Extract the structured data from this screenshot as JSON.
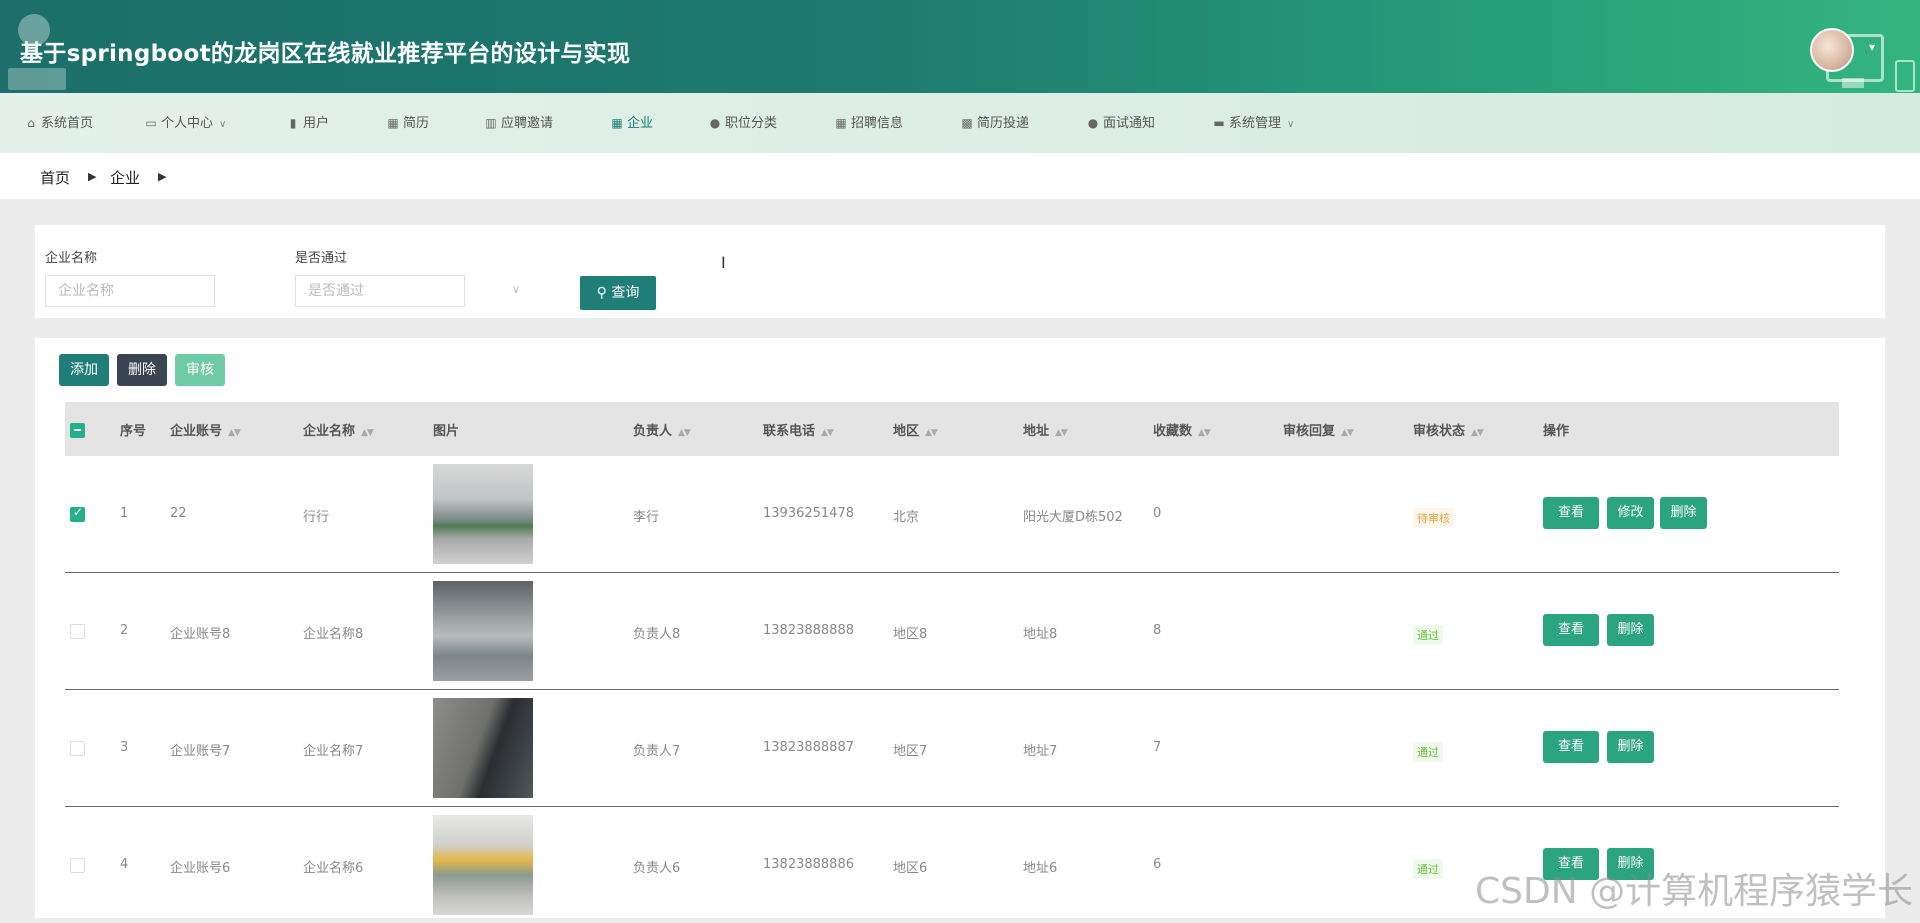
{
  "header": {
    "title": "基于springboot的龙岗区在线就业推荐平台的设计与实现"
  },
  "nav": {
    "items": [
      {
        "label": "系统首页",
        "icon": "home-icon"
      },
      {
        "label": "个人中心",
        "icon": "profile-icon",
        "dropdown": true
      },
      {
        "label": "用户",
        "icon": "bar-chart-icon"
      },
      {
        "label": "简历",
        "icon": "grid-icon"
      },
      {
        "label": "应聘邀请",
        "icon": "columns-icon"
      },
      {
        "label": "企业",
        "icon": "grid-icon",
        "active": true
      },
      {
        "label": "职位分类",
        "icon": "bulb-icon"
      },
      {
        "label": "招聘信息",
        "icon": "grid-icon"
      },
      {
        "label": "简历投递",
        "icon": "grid-dense-icon"
      },
      {
        "label": "面试通知",
        "icon": "person-icon"
      },
      {
        "label": "系统管理",
        "icon": "chat-icon",
        "dropdown": true
      }
    ]
  },
  "breadcrumb": {
    "home": "首页",
    "current": "企业"
  },
  "search": {
    "name_label": "企业名称",
    "name_placeholder": "企业名称",
    "pass_label": "是否通过",
    "pass_placeholder": "是否通过",
    "query_label": "查询"
  },
  "toolbar": {
    "add": "添加",
    "delete": "删除",
    "audit": "审核"
  },
  "colors": {
    "primary": "#1f7f78",
    "dark": "#3b4452",
    "audit": "#6fcaa6",
    "op": "#2aa57f"
  },
  "table": {
    "headers": [
      "序号",
      "企业账号",
      "企业名称",
      "图片",
      "负责人",
      "联系电话",
      "地区",
      "地址",
      "收藏数",
      "审核回复",
      "审核状态",
      "操作"
    ],
    "rows": [
      {
        "idx": "1",
        "account": "22",
        "name": "行行",
        "person": "李行",
        "phone": "13936251478",
        "region": "北京",
        "address": "阳光大厦D栋502",
        "fav": "0",
        "reply": "",
        "status": "待审核",
        "status_type": "pending",
        "checked": true,
        "ops": [
          "查看",
          "修改",
          "删除"
        ]
      },
      {
        "idx": "2",
        "account": "企业账号8",
        "name": "企业名称8",
        "person": "负责人8",
        "phone": "13823888888",
        "region": "地区8",
        "address": "地址8",
        "fav": "8",
        "reply": "",
        "status": "通过",
        "status_type": "pass",
        "checked": false,
        "ops": [
          "查看",
          "删除"
        ]
      },
      {
        "idx": "3",
        "account": "企业账号7",
        "name": "企业名称7",
        "person": "负责人7",
        "phone": "13823888887",
        "region": "地区7",
        "address": "地址7",
        "fav": "7",
        "reply": "",
        "status": "通过",
        "status_type": "pass",
        "checked": false,
        "ops": [
          "查看",
          "删除"
        ]
      },
      {
        "idx": "4",
        "account": "企业账号6",
        "name": "企业名称6",
        "person": "负责人6",
        "phone": "13823888886",
        "region": "地区6",
        "address": "地址6",
        "fav": "6",
        "reply": "",
        "status": "通过",
        "status_type": "pass",
        "checked": false,
        "ops": [
          "查看",
          "删除"
        ]
      }
    ]
  },
  "watermark": "CSDN @计算机程序猿学长"
}
